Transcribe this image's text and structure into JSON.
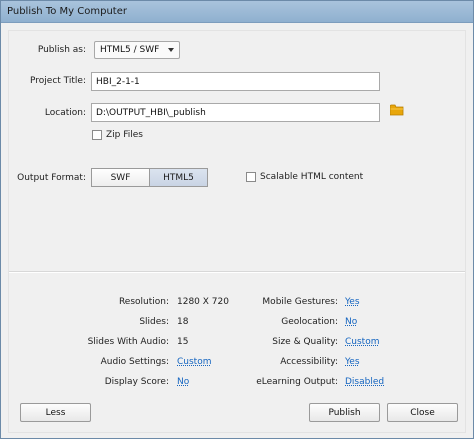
{
  "window": {
    "title": "Publish To My Computer"
  },
  "publish_as": {
    "label": "Publish as:",
    "value": "HTML5 / SWF"
  },
  "project_title": {
    "label": "Project Title:",
    "value": "HBI_2-1-1"
  },
  "location": {
    "label": "Location:",
    "value": "D:\\OUTPUT_HBI\\_publish",
    "icon": "folder-icon",
    "icon_color": "#e8a60a"
  },
  "zip_files": {
    "label": "Zip Files",
    "checked": false
  },
  "output_format": {
    "label": "Output Format:",
    "options": [
      "SWF",
      "HTML5"
    ],
    "selected": "HTML5"
  },
  "scalable": {
    "label": "Scalable HTML content",
    "checked": false
  },
  "summary": {
    "resolution": {
      "label": "Resolution:",
      "value": "1280 X 720"
    },
    "slides": {
      "label": "Slides:",
      "value": "18"
    },
    "slides_with_audio": {
      "label": "Slides With Audio:",
      "value": "15"
    },
    "audio_settings": {
      "label": "Audio Settings:",
      "value": "Custom"
    },
    "display_score": {
      "label": "Display Score:",
      "value": "No"
    },
    "mobile_gestures": {
      "label": "Mobile Gestures:",
      "value": "Yes"
    },
    "geolocation": {
      "label": "Geolocation:",
      "value": "No"
    },
    "size_quality": {
      "label": "Size & Quality:",
      "value": "Custom"
    },
    "accessibility": {
      "label": "Accessibility:",
      "value": "Yes"
    },
    "elearning_output": {
      "label": "eLearning Output:",
      "value": "Disabled"
    }
  },
  "buttons": {
    "less": "Less",
    "publish": "Publish",
    "close": "Close"
  },
  "colors": {
    "link": "#1565c0",
    "titlebar": "#9fbcd8"
  }
}
